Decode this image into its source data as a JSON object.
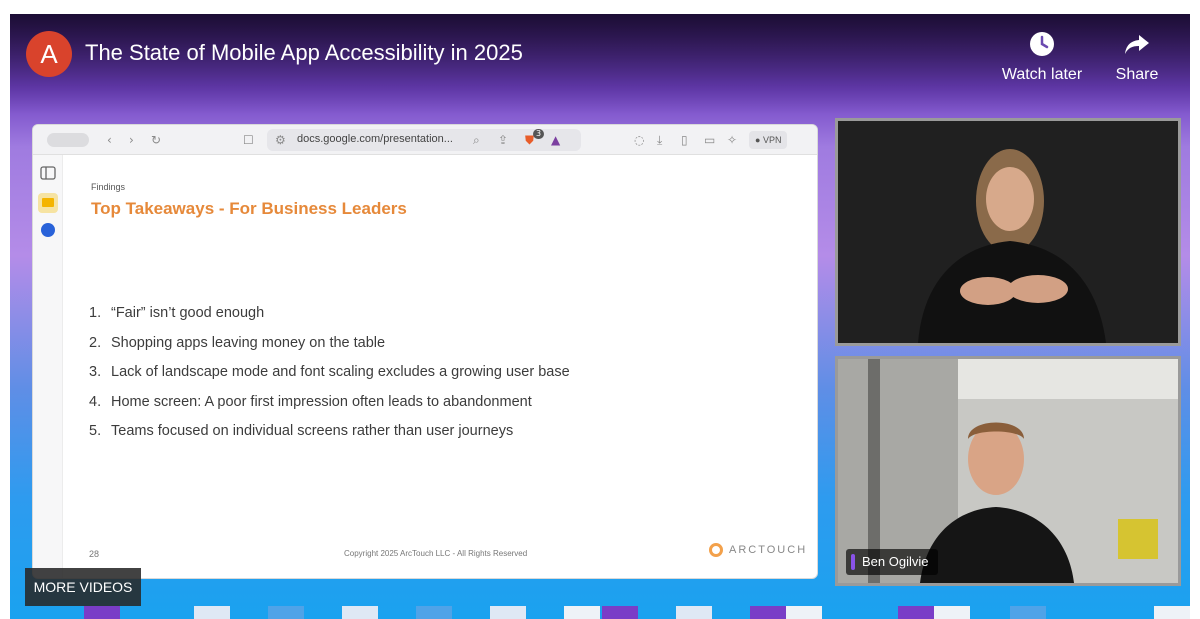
{
  "video": {
    "channel_initial": "A",
    "title": "The State of Mobile App Accessibility in 2025",
    "actions": {
      "watch_later": "Watch later",
      "share": "Share"
    },
    "more_videos": "MORE VIDEOS"
  },
  "browser": {
    "url": "docs.google.com/presentation...",
    "vpn_label": "VPN",
    "shield_badge": "3"
  },
  "slide": {
    "kicker": "Findings",
    "title": "Top Takeaways - For Business Leaders",
    "items": [
      {
        "num": "1.",
        "text": "“Fair” isn’t good enough"
      },
      {
        "num": "2.",
        "text": "Shopping apps leaving money on the table"
      },
      {
        "num": "3.",
        "text": "Lack of landscape mode and font scaling excludes a growing user base"
      },
      {
        "num": "4.",
        "text": "Home screen: A poor first impression often leads to abandonment"
      },
      {
        "num": "5.",
        "text": "Teams focused on individual screens rather than user journeys"
      }
    ],
    "page_number": "28",
    "copyright": "Copyright 2025 ArcTouch LLC - All Rights Reserved",
    "brand": "ARCTOUCH"
  },
  "participants": [
    {
      "name": ""
    },
    {
      "name": "Ben Ogilvie"
    }
  ],
  "colors": {
    "slide_title": "#e6893a",
    "avatar": "#d9432c",
    "name_tag_accent": "#8a53e8"
  }
}
